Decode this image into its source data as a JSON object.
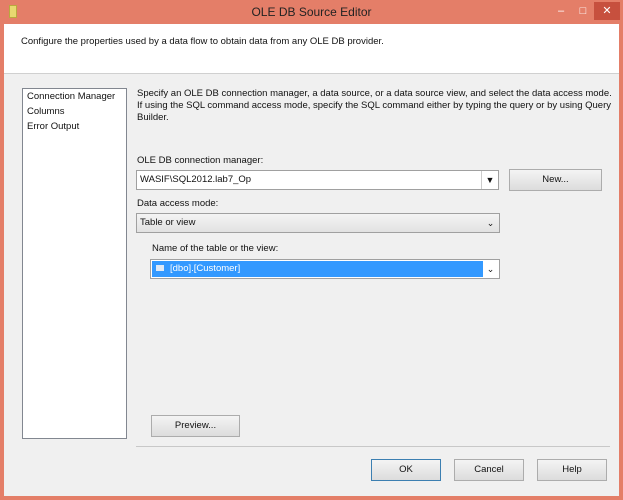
{
  "window": {
    "title": "OLE DB Source Editor",
    "minimize": "–",
    "maximize": "□",
    "close": "✕"
  },
  "header": {
    "description": "Configure the properties used by a data flow to obtain data from any OLE DB provider."
  },
  "nav": {
    "items": [
      {
        "label": "Connection Manager"
      },
      {
        "label": "Columns"
      },
      {
        "label": "Error Output"
      }
    ]
  },
  "main": {
    "instructions": "Specify an OLE DB connection manager, a data source, or a data source view, and select the data access mode. If using the SQL command access mode, specify the SQL command either by typing the query or by using Query Builder.",
    "connection_label": "OLE DB connection manager:",
    "connection_value": "WASIF\\SQL2012.lab7_Op",
    "new_button": "New...",
    "access_mode_label": "Data access mode:",
    "access_mode_value": "Table or view",
    "table_label": "Name of the table or the view:",
    "table_value": "[dbo].[Customer]",
    "preview_button": "Preview..."
  },
  "footer": {
    "ok": "OK",
    "cancel": "Cancel",
    "help": "Help"
  }
}
